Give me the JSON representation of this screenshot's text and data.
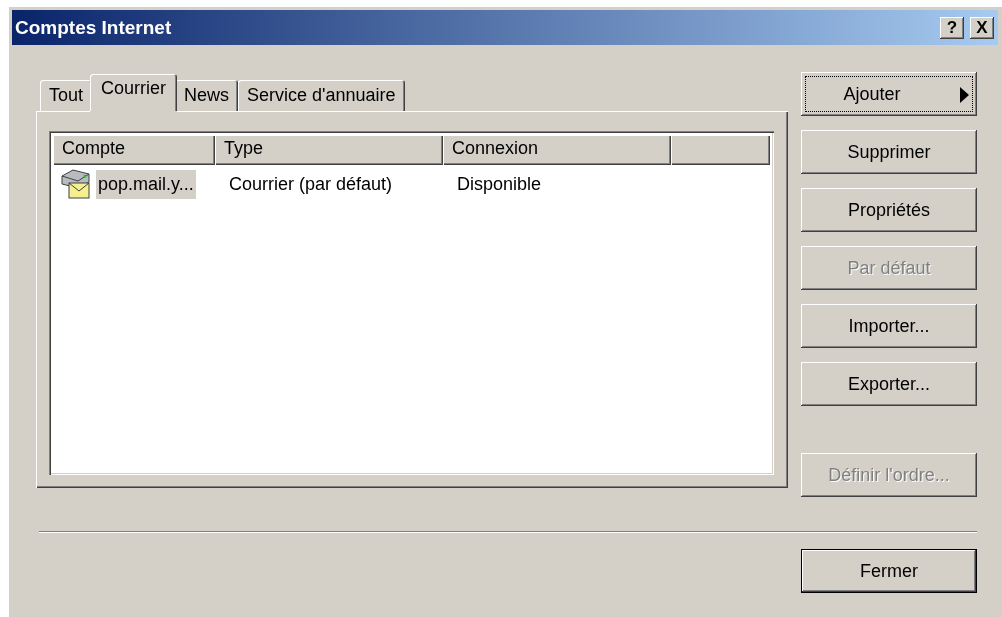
{
  "window": {
    "title": "Comptes Internet",
    "help_button": "?",
    "close_button": "X"
  },
  "tabs": [
    {
      "label": "Tout",
      "selected": false
    },
    {
      "label": "Courrier",
      "selected": true
    },
    {
      "label": "News",
      "selected": false
    },
    {
      "label": "Service d'annuaire",
      "selected": false
    }
  ],
  "table": {
    "columns": [
      "Compte",
      "Type",
      "Connexion"
    ],
    "rows": [
      {
        "cells": [
          "pop.mail.y...",
          "Courrier (par défaut)",
          "Disponible"
        ],
        "selected": true
      }
    ]
  },
  "buttons": [
    {
      "label": "Ajouter",
      "kind": "submenu",
      "disabled": false,
      "focused": true
    },
    {
      "label": "Supprimer",
      "kind": "plain",
      "disabled": false,
      "focused": false
    },
    {
      "label": "Propriétés",
      "kind": "plain",
      "disabled": false,
      "focused": false
    },
    {
      "label": "Par défaut",
      "kind": "plain",
      "disabled": true,
      "focused": false
    },
    {
      "label": "Importer...",
      "kind": "plain",
      "disabled": false,
      "focused": false
    },
    {
      "label": "Exporter...",
      "kind": "plain",
      "disabled": false,
      "focused": false
    },
    {
      "label": "Définir l'ordre...",
      "kind": "plain",
      "disabled": true,
      "focused": false
    }
  ],
  "close_button": {
    "label": "Fermer"
  }
}
